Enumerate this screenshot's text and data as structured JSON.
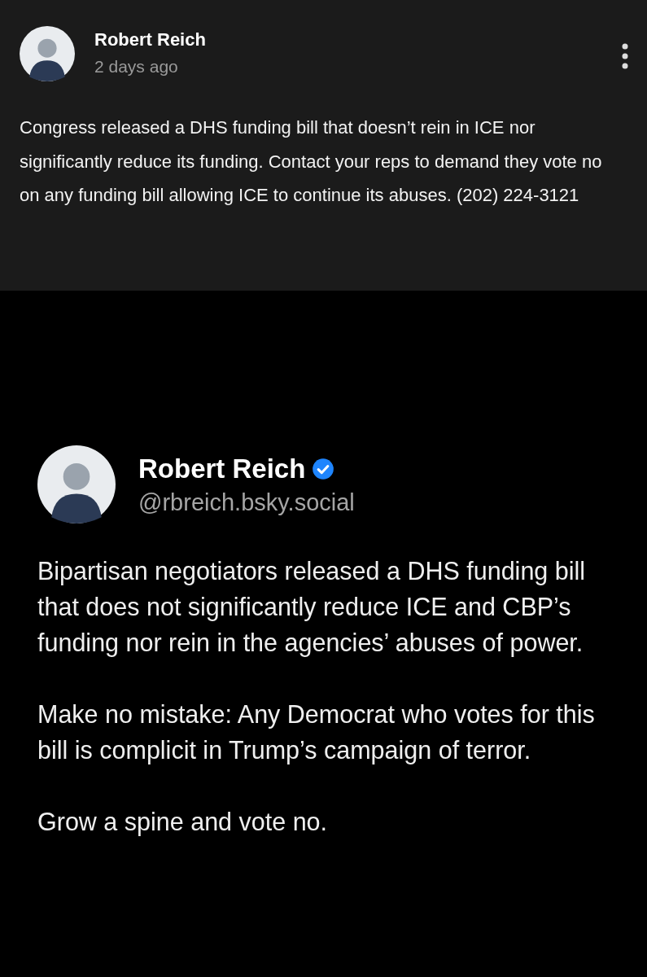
{
  "post": {
    "author": "Robert Reich",
    "time": "2 days ago",
    "text": "Congress released a DHS funding bill that doesn’t rein in ICE nor significantly reduce its funding. Contact your reps to demand they vote no on any funding bill allowing ICE to continue its abuses. (202) 224-3121"
  },
  "embed": {
    "author": "Robert Reich",
    "verified": true,
    "handle": "@rbreich.bsky.social",
    "paragraphs": [
      "Bipartisan negotiators released a DHS funding bill that does not significantly reduce ICE and CBP’s funding nor rein in the agencies’ abuses of power.",
      "Make no mistake: Any Democrat who votes for this bill is complicit in Trump’s campaign of terror.",
      "Grow a spine and vote no."
    ]
  }
}
